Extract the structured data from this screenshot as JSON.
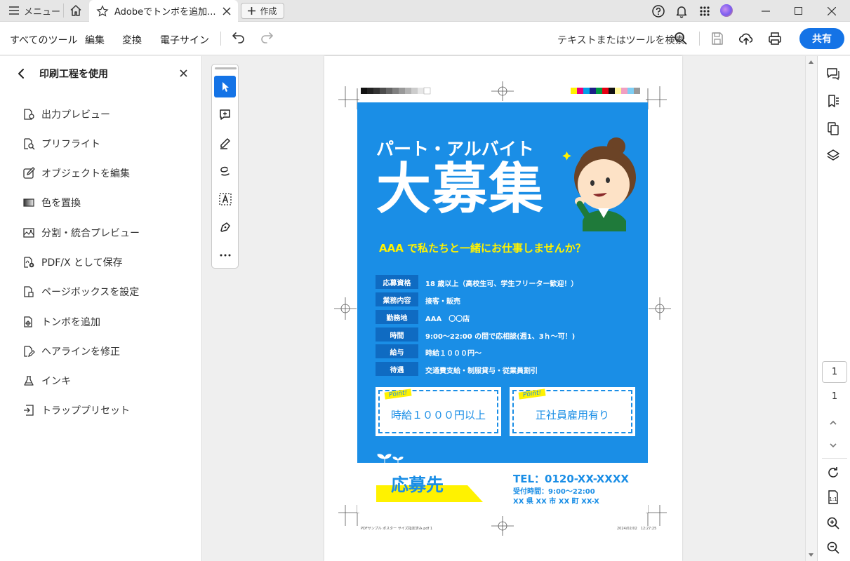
{
  "titlebar": {
    "menu_label": "メニュー",
    "tab_title": "Adobeでトンボを追加...",
    "new_label": "作成"
  },
  "toolbar": {
    "menus": [
      "すべてのツール",
      "編集",
      "変換",
      "電子サイン"
    ],
    "search_placeholder": "テキストまたはツールを検索",
    "share_label": "共有"
  },
  "left_panel": {
    "title": "印刷工程を使用",
    "items": [
      {
        "label": "出力プレビュー",
        "icon": "output-preview-icon"
      },
      {
        "label": "プリフライト",
        "icon": "preflight-icon"
      },
      {
        "label": "オブジェクトを編集",
        "icon": "edit-object-icon"
      },
      {
        "label": "色を置換",
        "icon": "replace-color-icon"
      },
      {
        "label": "分割・統合プレビュー",
        "icon": "flattener-preview-icon"
      },
      {
        "label": "PDF/X として保存",
        "icon": "pdfx-save-icon"
      },
      {
        "label": "ページボックスを設定",
        "icon": "page-box-icon"
      },
      {
        "label": "トンボを追加",
        "icon": "add-printer-marks-icon"
      },
      {
        "label": "ヘアラインを修正",
        "icon": "fix-hairline-icon"
      },
      {
        "label": "インキ",
        "icon": "ink-icon"
      },
      {
        "label": "トラッププリセット",
        "icon": "trap-preset-icon"
      }
    ]
  },
  "poster": {
    "subtitle": "パート・アルバイト",
    "headline": "大募集",
    "tagline": "AAA で私たちと一緒にお仕事しませんか？",
    "rows": [
      {
        "label": "応募資格",
        "value": "18 歳以上（高校生可、学生フリーター歓迎！）"
      },
      {
        "label": "業務内容",
        "value": "接客・販売"
      },
      {
        "label": "勤務地",
        "value": "AAA　〇〇店"
      },
      {
        "label": "時間",
        "value": "9:00～22:00 の間で応相談(週1、3ｈ～可！)"
      },
      {
        "label": "給与",
        "value": "時給１０００円～"
      },
      {
        "label": "待遇",
        "value": "交通費支給・制服貸与・従業員割引"
      }
    ],
    "points": [
      {
        "tag": "Point!",
        "text": "時給１０００円以上"
      },
      {
        "tag": "Point!",
        "text": "正社員雇用有り"
      }
    ],
    "contact_title": "応募先",
    "tel": "TEL：0120-XX-XXXX",
    "hours": "受付時間：9:00～22:00",
    "address": "XX 県 XX 市 XX 町 XX-X",
    "footer_left": "PDFサンプル ポスター サイズ指定済み.pdf  1",
    "footer_right": "2024/02/02　12:27:25"
  },
  "pagination": {
    "current": "1",
    "total": "1"
  },
  "colors": {
    "accent": "#1473e6",
    "poster_blue": "#1a8ee6",
    "highlight_yellow": "#fff200"
  }
}
